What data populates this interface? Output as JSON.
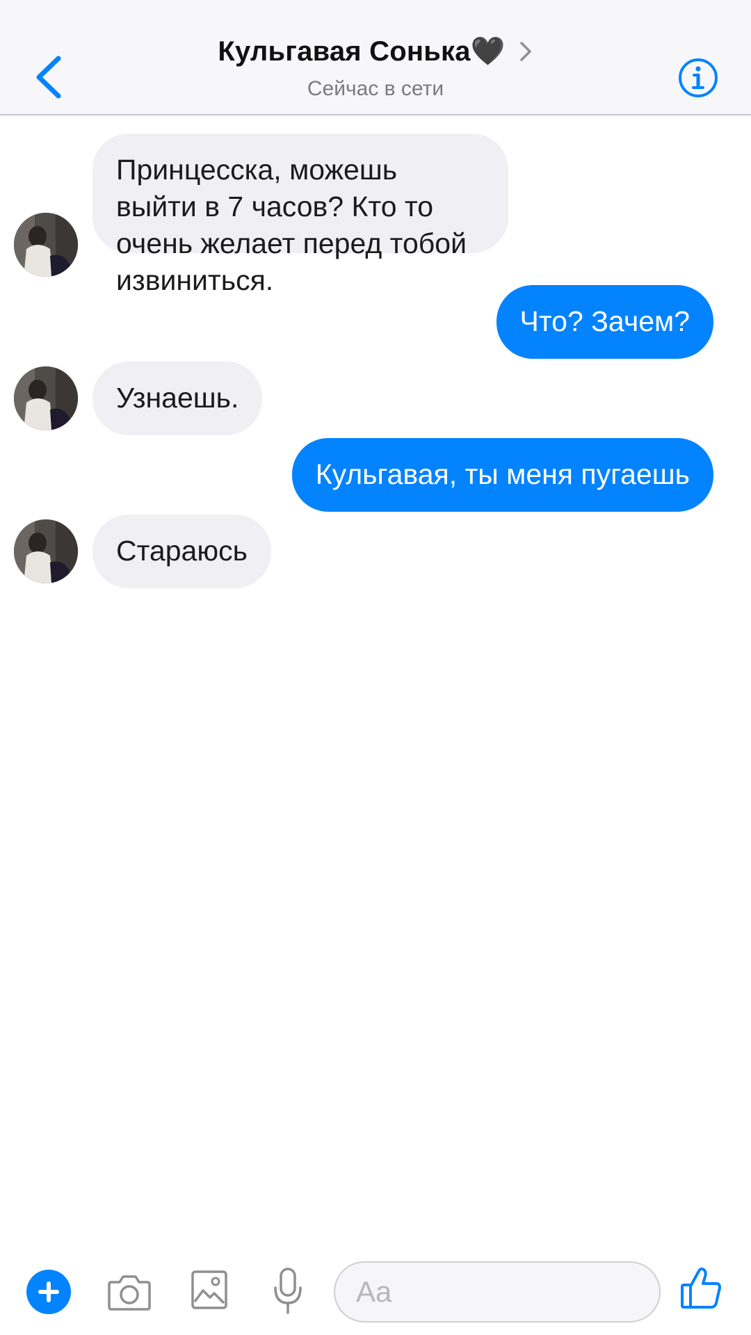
{
  "header": {
    "title": "Кульгавая Сонька🖤",
    "status": "Сейчас в сети"
  },
  "messages": [
    {
      "side": "in",
      "text": "Принцесска, можешь выйти в 7 часов? Кто то очень желает перед тобой извиниться."
    },
    {
      "side": "out",
      "text": "Что? Зачем?"
    },
    {
      "side": "in",
      "text": "Узнаешь."
    },
    {
      "side": "out",
      "text": "Кульгавая, ты меня пугаешь"
    },
    {
      "side": "in",
      "text": "Стараюсь"
    }
  ],
  "composer": {
    "placeholder": "Aa"
  },
  "colors": {
    "accent": "#0483FE",
    "incoming_bubble": "#F0EFF4",
    "header_bg": "#F7F7F9"
  },
  "icons": {
    "back": "chevron-left-icon",
    "title_chevron": "chevron-right-icon",
    "info": "info-icon",
    "plus": "plus-icon",
    "camera": "camera-icon",
    "image": "image-icon",
    "mic": "microphone-icon",
    "like": "thumbs-up-icon"
  }
}
